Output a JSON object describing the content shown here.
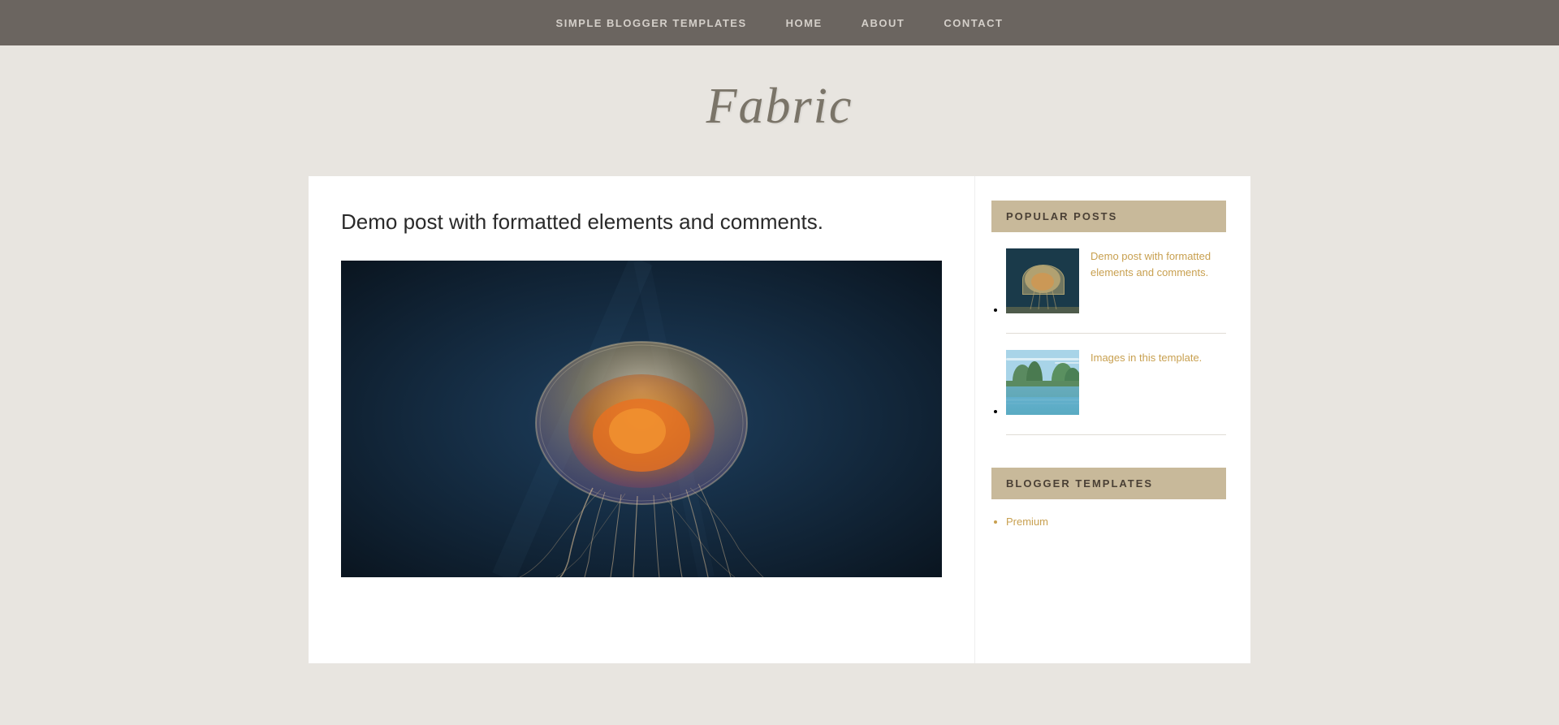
{
  "nav": {
    "brand": "SIMPLE BLOGGER TEMPLATES",
    "links": [
      {
        "label": "HOME",
        "href": "#"
      },
      {
        "label": "ABOUT",
        "href": "#"
      },
      {
        "label": "CONTACT",
        "href": "#"
      }
    ]
  },
  "header": {
    "site_title": "Fabric"
  },
  "main": {
    "post": {
      "title": "Demo post with formatted elements and comments.",
      "image_alt": "Jellyfish underwater photo"
    }
  },
  "sidebar": {
    "popular_posts": {
      "widget_title": "POPULAR POSTS",
      "items": [
        {
          "title": "Demo post with formatted elements and comments.",
          "href": "#",
          "thumb_type": "jellyfish"
        },
        {
          "title": "Images in this template.",
          "href": "#",
          "thumb_type": "river"
        }
      ]
    },
    "blogger_templates": {
      "widget_title": "BLOGGER TEMPLATES",
      "items": [
        {
          "label": "Premium",
          "href": "#"
        }
      ]
    }
  }
}
